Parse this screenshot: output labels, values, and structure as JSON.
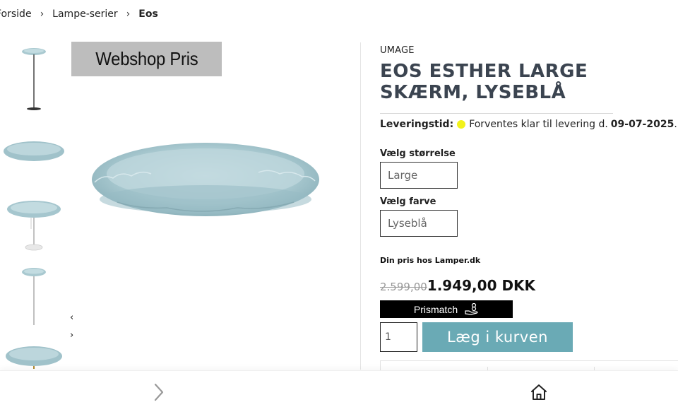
{
  "breadcrumb": {
    "items": [
      "Forside",
      "Lampe-serier",
      "Eos"
    ],
    "separator": "›"
  },
  "gallery": {
    "badge_text": "Webshop Pris",
    "prev_label": "‹",
    "next_label": "›",
    "thumbnails": [
      "floor-lamp-thumbnail",
      "shade-thumbnail",
      "table-lamp-thumbnail",
      "floor-lamp-tall-thumbnail",
      "shade-partial-thumbnail"
    ],
    "main_image": "feather-lampshade-image"
  },
  "product": {
    "brand": "UMAGE",
    "title": "EOS ESTHER LARGE SKÆRM, LYSEBLÅ",
    "delivery": {
      "label": "Leveringstid:",
      "text": "Forventes klar til levering d.",
      "date": "09-07-2025",
      "suffix": ".",
      "status_color": "#f2f21a"
    },
    "size": {
      "label": "Vælg størrelse",
      "value": "Large"
    },
    "color": {
      "label": "Vælg farve",
      "value": "Lyseblå"
    },
    "price_label": "Din pris hos Lamper.dk",
    "old_price": "2.599,00",
    "new_price": "1.949,00 DKK",
    "prismatch_label": "Prismatch",
    "quantity": "1",
    "add_to_cart_label": "Læg i kurven"
  },
  "colors": {
    "accent": "#6aaab5",
    "title": "#3b4450",
    "badge_bg": "#bdbdbd",
    "shade": "#a9c9d0"
  },
  "bottom_nav": {
    "forward_icon": "chevron-right-icon",
    "home_icon": "home-icon"
  }
}
